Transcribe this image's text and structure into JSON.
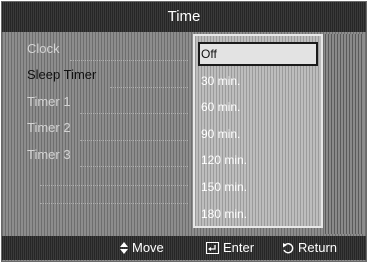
{
  "title": "Time",
  "menu": [
    {
      "label": "Clock",
      "active": false
    },
    {
      "label": "Sleep Timer",
      "active": true
    },
    {
      "label": "Timer 1",
      "active": false
    },
    {
      "label": "Timer 2",
      "active": false
    },
    {
      "label": "Timer 3",
      "active": false
    }
  ],
  "sleep_timer_options": [
    "Off",
    "30 min.",
    "60 min.",
    "90 min.",
    "120 min.",
    "150 min.",
    "180 min."
  ],
  "selected_option": "Off",
  "bottom_bar": {
    "move_label": "Move",
    "enter_label": "Enter",
    "return_label": "Return"
  },
  "icons": {
    "move": "up-down-arrows-icon",
    "enter": "enter-icon",
    "return": "return-icon"
  }
}
